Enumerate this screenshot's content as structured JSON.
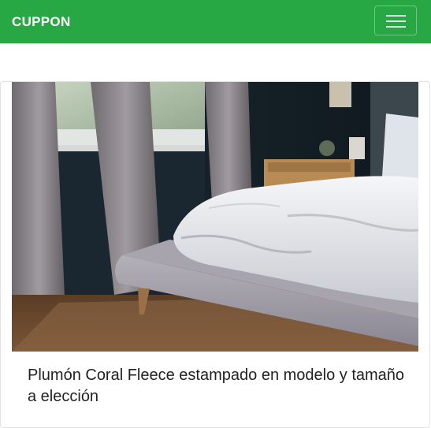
{
  "navbar": {
    "brand": "CUPPON",
    "brand_color": "#28a745",
    "menu_icon": "hamburger-menu-icon"
  },
  "card": {
    "image_alt": "Cama con plumón blanco junto a una ventana con cortinas",
    "title": "Plumón Coral Fleece estampado en modelo y tamaño a elección"
  }
}
